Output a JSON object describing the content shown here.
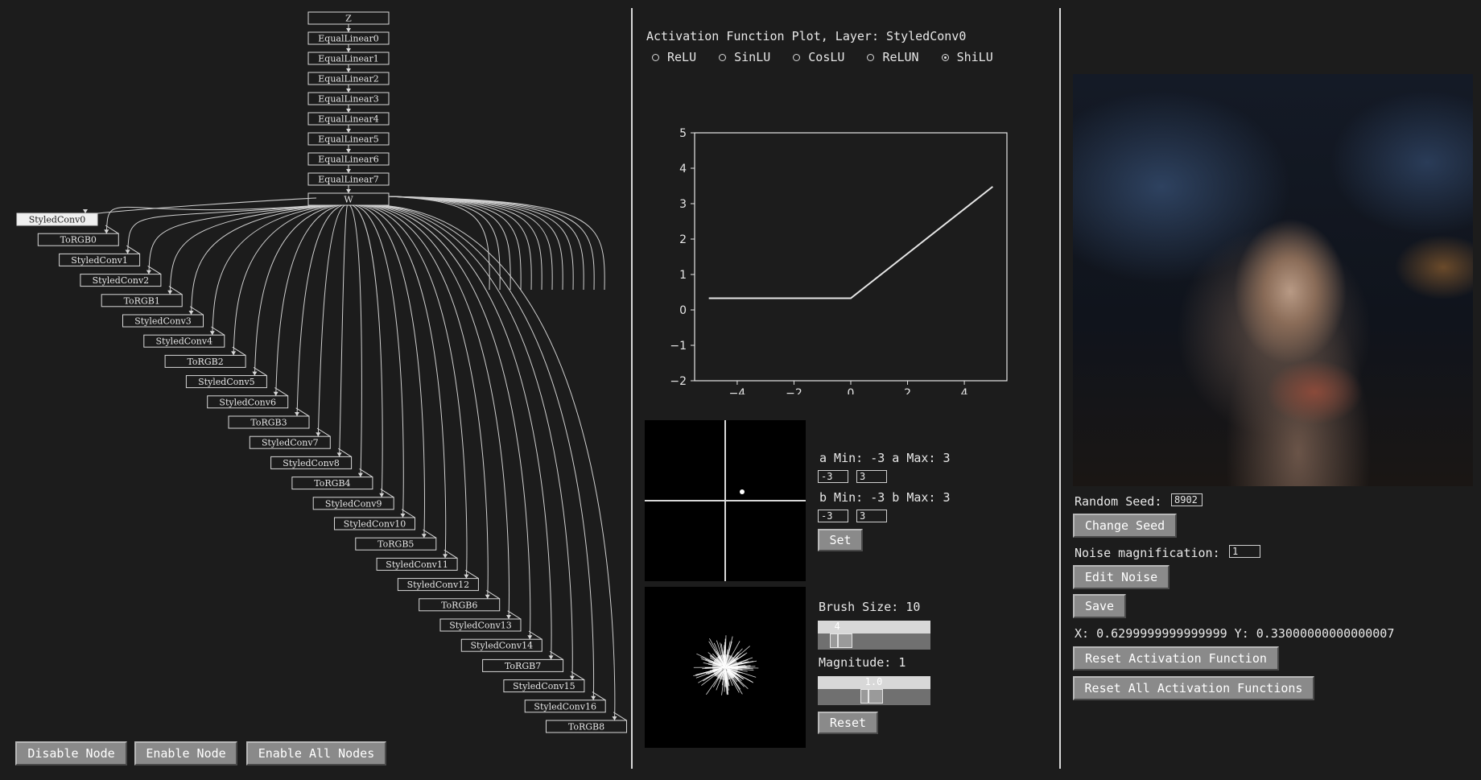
{
  "graph": {
    "top_chain": [
      "Z",
      "EqualLinear0",
      "EqualLinear1",
      "EqualLinear2",
      "EqualLinear3",
      "EqualLinear4",
      "EqualLinear5",
      "EqualLinear6",
      "EqualLinear7",
      "W"
    ],
    "layers": [
      "StyledConv0",
      "ToRGB0",
      "StyledConv1",
      "StyledConv2",
      "ToRGB1",
      "StyledConv3",
      "StyledConv4",
      "ToRGB2",
      "StyledConv5",
      "StyledConv6",
      "ToRGB3",
      "StyledConv7",
      "StyledConv8",
      "ToRGB4",
      "StyledConv9",
      "StyledConv10",
      "ToRGB5",
      "StyledConv11",
      "StyledConv12",
      "ToRGB6",
      "StyledConv13",
      "StyledConv14",
      "ToRGB7",
      "StyledConv15",
      "StyledConv16",
      "ToRGB8"
    ],
    "selected": "StyledConv0"
  },
  "node_buttons": {
    "disable": "Disable Node",
    "enable": "Enable Node",
    "enable_all": "Enable All Nodes"
  },
  "activation": {
    "title": "Activation Function Plot, Layer: StyledConv0",
    "options": [
      "ReLU",
      "SinLU",
      "CosLU",
      "ReLUN",
      "ShiLU"
    ],
    "selected": "ShiLU"
  },
  "chart_data": {
    "type": "line",
    "x": [
      -5,
      0,
      5
    ],
    "y": [
      0.33,
      0.33,
      3.48
    ],
    "xlim": [
      -5.5,
      5.5
    ],
    "ylim": [
      -2,
      5
    ],
    "xticks": [
      "−4",
      "−2",
      "0",
      "2",
      "4"
    ],
    "xtick_values": [
      -4,
      -2,
      0,
      2,
      4
    ],
    "yticks": [
      "−2",
      "−1",
      "0",
      "1",
      "2",
      "3",
      "4",
      "5"
    ],
    "ytick_values": [
      -2,
      -1,
      0,
      1,
      2,
      3,
      4,
      5
    ],
    "line_color": "#e6e6e6",
    "grid": false
  },
  "ab_params": {
    "a_label": "a Min: -3  a Max: 3",
    "a_min": "-3",
    "a_max": "3",
    "b_label": "b Min: -3  b Max: 3",
    "b_min": "-3",
    "b_max": "3",
    "set_label": "Set",
    "point": {
      "a": 0.63,
      "b": 0.33
    }
  },
  "brush": {
    "size_label": "Brush Size: 10",
    "size_slider_value": "4",
    "size_fraction": 0.13,
    "magnitude_label": "Magnitude: 1",
    "magnitude_slider_value": "1.0",
    "magnitude_fraction": 0.47,
    "reset_label": "Reset"
  },
  "controls": {
    "random_seed_label": "Random Seed:",
    "random_seed_value": "8902",
    "change_seed": "Change Seed",
    "noise_label": "Noise magnification:",
    "noise_value": "1",
    "edit_noise": "Edit Noise",
    "save": "Save",
    "coords": "X: 0.6299999999999999  Y: 0.33000000000000007",
    "reset_activation": "Reset Activation Function",
    "reset_all": "Reset All Activation Functions"
  },
  "colors": {
    "background": "#1c1c1c",
    "button": "#8a8a8a",
    "text": "#e6e6e6"
  }
}
